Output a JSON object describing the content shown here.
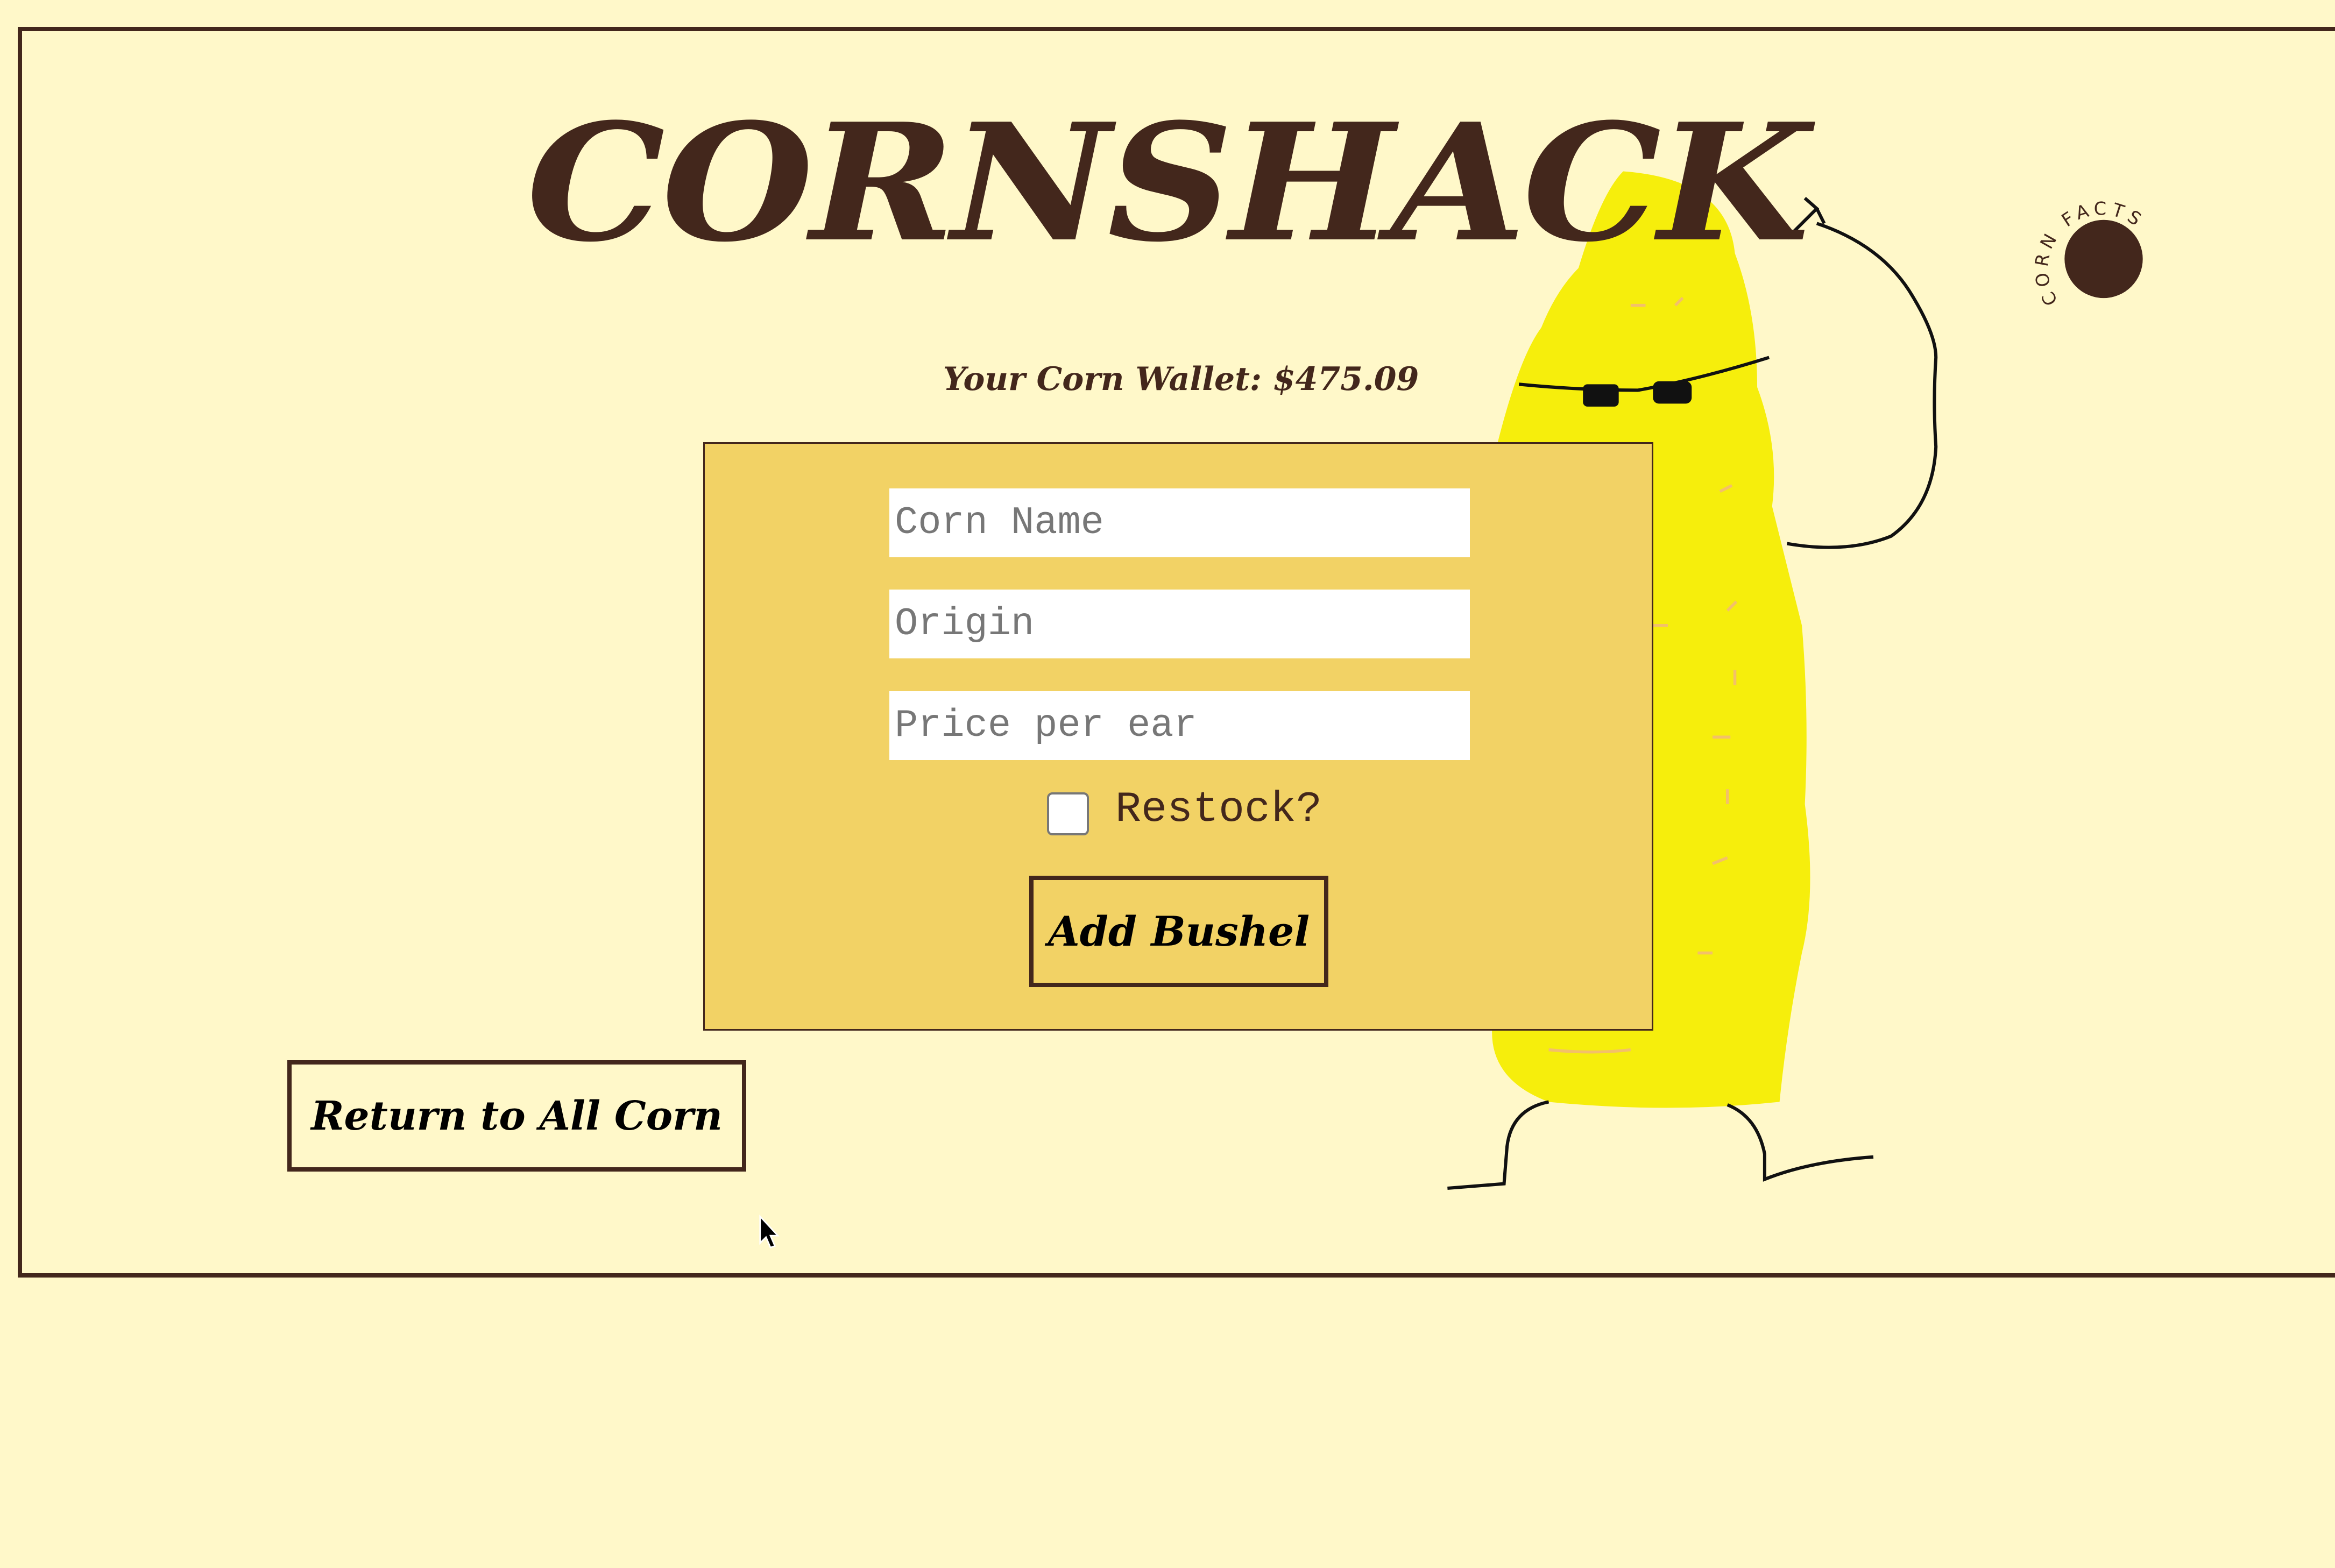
{
  "header": {
    "title": "CORNSHACK",
    "wallet": "Your Corn Wallet: $475.09"
  },
  "badge": {
    "label": "CORN FACTS"
  },
  "form": {
    "corn_name_placeholder": "Corn Name",
    "origin_placeholder": "Origin",
    "price_placeholder": "Price per ear",
    "restock_label": "Restock?",
    "restock_checked": false,
    "submit_label": "Add Bushel"
  },
  "nav": {
    "return_label": "Return to All Corn"
  },
  "colors": {
    "background": "#fff8c9",
    "brown": "#43271c",
    "form_bg": "#f2d265",
    "corn_yellow": "#f6ee0c"
  }
}
